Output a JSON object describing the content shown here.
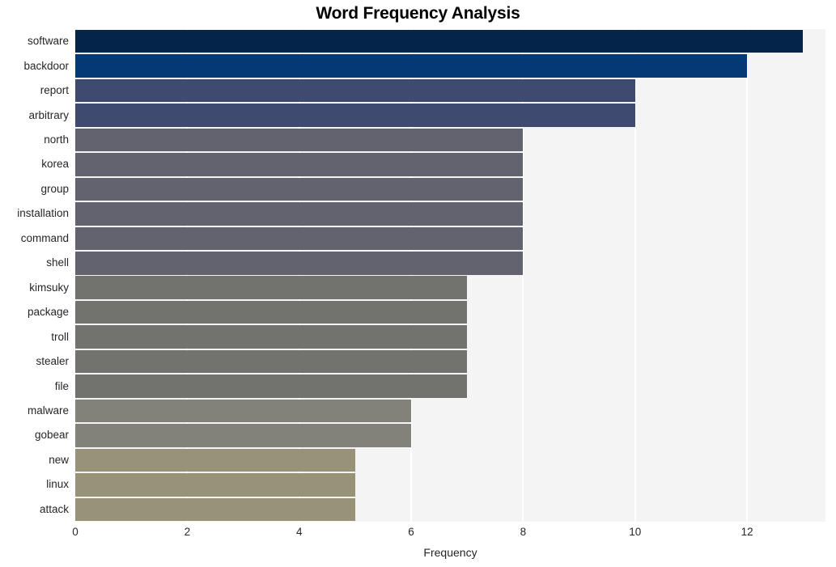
{
  "chart_data": {
    "type": "bar",
    "orientation": "horizontal",
    "title": "Word Frequency Analysis",
    "xlabel": "Frequency",
    "ylabel": "",
    "xlim": [
      0,
      13.4
    ],
    "xticks": [
      0,
      2,
      4,
      6,
      8,
      10,
      12
    ],
    "xtick_labels": [
      "0",
      "2",
      "4",
      "6",
      "8",
      "10",
      "12"
    ],
    "grid": true,
    "grid_axis": "x",
    "legend": null,
    "categories": [
      "software",
      "backdoor",
      "report",
      "arbitrary",
      "north",
      "korea",
      "group",
      "installation",
      "command",
      "shell",
      "kimsuky",
      "package",
      "troll",
      "stealer",
      "file",
      "malware",
      "gobear",
      "new",
      "linux",
      "attack"
    ],
    "values": [
      13,
      12,
      10,
      10,
      8,
      8,
      8,
      8,
      8,
      8,
      7,
      7,
      7,
      7,
      7,
      6,
      6,
      5,
      5,
      5
    ],
    "colors": [
      "#05244a",
      "#033a75",
      "#3e4a70",
      "#3e4a70",
      "#62636f",
      "#62636f",
      "#62636f",
      "#62636f",
      "#62636f",
      "#62636f",
      "#72726f",
      "#72726f",
      "#72726f",
      "#72726f",
      "#72726f",
      "#83827a",
      "#83827a",
      "#989279",
      "#989279",
      "#989279"
    ],
    "plot_background": "#f4f4f5",
    "grid_color": "#ffffff",
    "figure_background": "#ffffff"
  }
}
